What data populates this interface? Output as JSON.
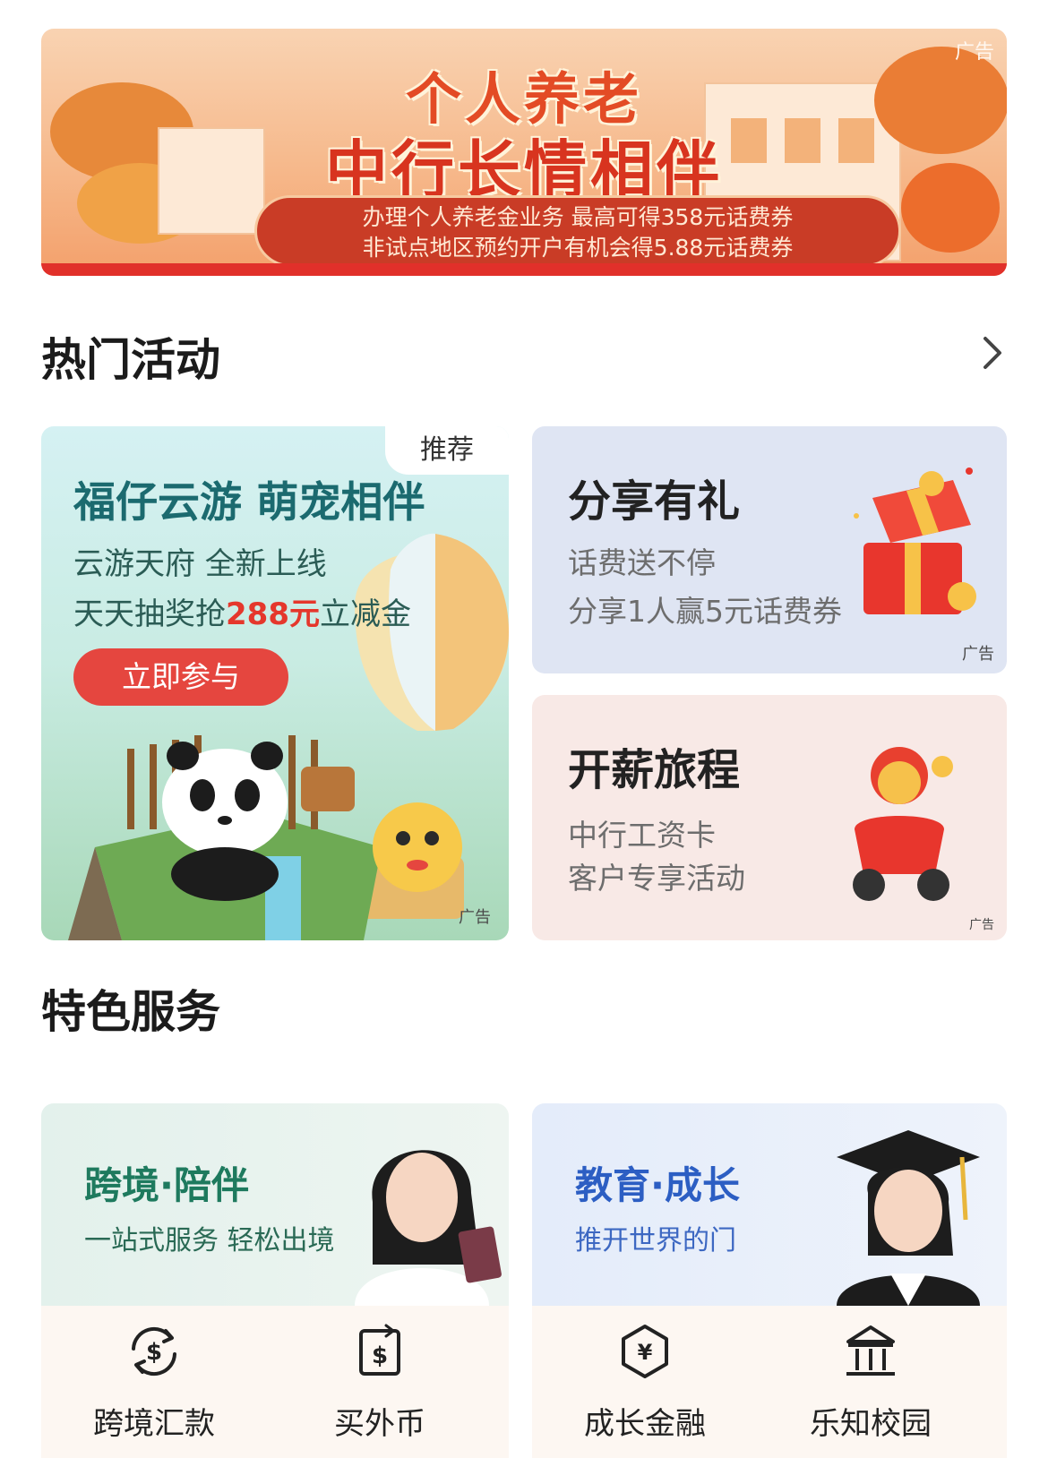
{
  "banner": {
    "ad_tag": "广告",
    "title_line1": "个人养老",
    "title_line2": "中行长情相伴",
    "desc_line1": "办理个人养老金业务 最高可得358元话费券",
    "desc_line2": "非试点地区预约开户有机会得5.88元话费券"
  },
  "hot": {
    "title": "热门活动",
    "more_icon": "chevron-right-icon",
    "cards": {
      "featured": {
        "badge": "推荐",
        "title": "福仔云游 萌宠相伴",
        "line1": "云游天府 全新上线",
        "line2_prefix": "天天抽奖抢",
        "line2_highlight": "288元",
        "line2_suffix": "立减金",
        "button": "立即参与",
        "ad_tag": "广告"
      },
      "share": {
        "title": "分享有礼",
        "line1": "话费送不停",
        "line2": "分享1人赢5元话费券",
        "ad_tag": "广告",
        "icon": "gift-box-icon"
      },
      "salary": {
        "title": "开薪旅程",
        "line1": "中行工资卡",
        "line2": "客户专享活动",
        "ad_tag": "广告",
        "icon": "scooter-mascot-icon"
      }
    }
  },
  "services": {
    "title": "特色服务",
    "cross_border": {
      "title": "跨境·陪伴",
      "subtitle": "一站式服务 轻松出境",
      "items": [
        {
          "label": "跨境汇款",
          "icon": "dollar-exchange-icon"
        },
        {
          "label": "买外币",
          "icon": "dollar-bill-icon"
        }
      ]
    },
    "education": {
      "title": "教育·成长",
      "subtitle": "推开世界的门",
      "items": [
        {
          "label": "成长金融",
          "icon": "yuan-hexagon-icon"
        },
        {
          "label": "乐知校园",
          "icon": "campus-building-icon"
        }
      ]
    }
  },
  "colors": {
    "accent_red": "#e5463f",
    "teal_text": "#1b6a6f",
    "green_text": "#1e7a5e",
    "blue_text": "#2c5ec3"
  }
}
